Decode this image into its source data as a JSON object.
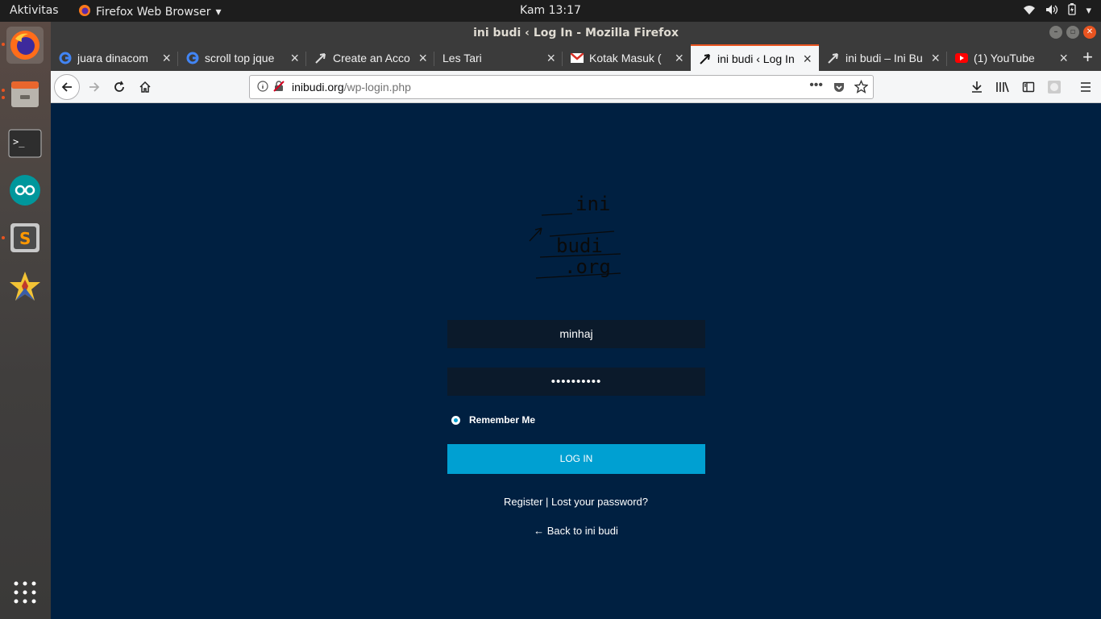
{
  "topbar": {
    "activities": "Aktivitas",
    "app_name": "Firefox Web Browser",
    "clock": "Kam 13:17"
  },
  "dock": {
    "items": [
      "Firefox",
      "Files",
      "Terminal",
      "Arduino",
      "Sublime Text",
      "Starred app"
    ]
  },
  "window": {
    "title": "ini budi ‹ Log In - Mozilla Firefox"
  },
  "tabs": [
    {
      "label": "juara dinacom",
      "icon": "google-icon"
    },
    {
      "label": "scroll top jque",
      "icon": "google-icon"
    },
    {
      "label": "Create an Acco",
      "icon": "arrow-logo-icon"
    },
    {
      "label": "Les Tari",
      "icon": ""
    },
    {
      "label": "Kotak Masuk (",
      "icon": "gmail-icon"
    },
    {
      "label": "ini budi ‹ Log In",
      "icon": "arrow-logo-icon",
      "selected": true
    },
    {
      "label": "ini budi – Ini Bu",
      "icon": "arrow-logo-icon"
    },
    {
      "label": "(1) YouTube",
      "icon": "youtube-icon"
    }
  ],
  "urlbar": {
    "host": "inibudi.org",
    "path": "/wp-login.php"
  },
  "login": {
    "logo_text": [
      "ini",
      "budi",
      ".org"
    ],
    "username": "minhaj",
    "password_mask": "••••••••••",
    "remember_label": "Remember Me",
    "login_button": "LOG IN",
    "register_link": "Register",
    "link_separator": " | ",
    "lost_password_link": "Lost your password?",
    "back_link": "← Back to ini budi"
  },
  "colors": {
    "page_background": "#002041",
    "button": "#00a0d2",
    "accent": "#e95420"
  }
}
